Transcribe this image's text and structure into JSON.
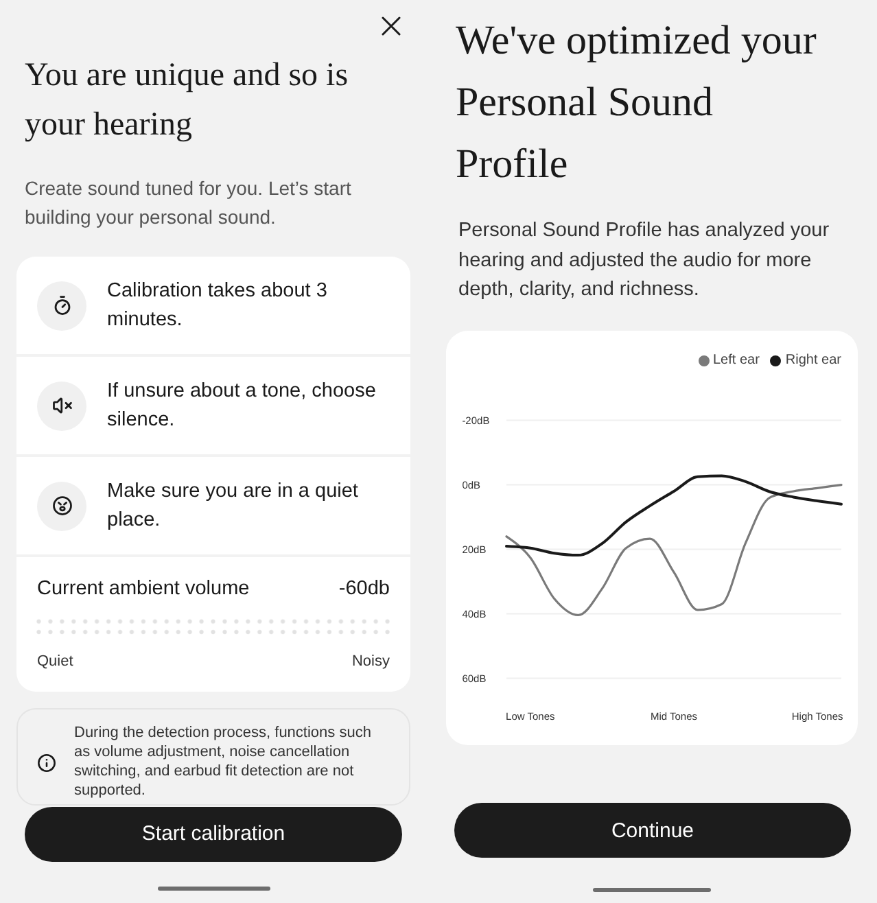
{
  "left_screen": {
    "title": "You are unique and so is your hearing",
    "subtitle": "Create sound tuned for you. Let’s start building your personal sound.",
    "tips": [
      {
        "text": "Calibration takes about 3 minutes."
      },
      {
        "text": "If unsure about a tone, choose silence."
      },
      {
        "text": "Make sure you are in a quiet place."
      }
    ],
    "ambient": {
      "label": "Current ambient volume",
      "reading": "-60db",
      "min_label": "Quiet",
      "max_label": "Noisy"
    },
    "notice": "During the detection process, functions such as volume adjustment, noise cancellation switching, and earbud fit detection are not supported.",
    "button": "Start calibration"
  },
  "right_screen": {
    "title": "We've optimized your Personal Sound Profile",
    "description": "Personal Sound Profile has analyzed your hearing and adjusted the audio for more depth, clarity, and richness.",
    "chart_data": {
      "type": "line",
      "legend": true,
      "grid": true,
      "categories": [
        null,
        "Low Tones",
        null,
        null,
        null,
        null,
        null,
        "Mid Tones",
        null,
        null,
        null,
        null,
        null,
        "High Tones",
        null
      ],
      "ylim": [
        60,
        -20
      ],
      "yticks": [
        {
          "value": -20,
          "label": "-20dB"
        },
        {
          "value": 0,
          "label": "0dB"
        },
        {
          "value": 20,
          "label": "20dB"
        },
        {
          "value": 40,
          "label": "40dB"
        },
        {
          "value": 60,
          "label": "60dB"
        }
      ],
      "series": [
        {
          "name": "Left ear",
          "color": "#7a7a7a",
          "values": [
            16,
            22.6,
            35.3,
            40.4,
            32.2,
            19.6,
            16.7,
            27.1,
            38.8,
            37,
            18,
            4,
            2,
            1,
            0
          ]
        },
        {
          "name": "Right ear",
          "color": "#1a1a1a",
          "values": [
            19,
            19.6,
            21.2,
            21.8,
            18.2,
            11.5,
            6.5,
            2,
            -2.5,
            -2.8,
            -1,
            2.1,
            3.8,
            5,
            6
          ]
        }
      ]
    },
    "button": "Continue"
  }
}
